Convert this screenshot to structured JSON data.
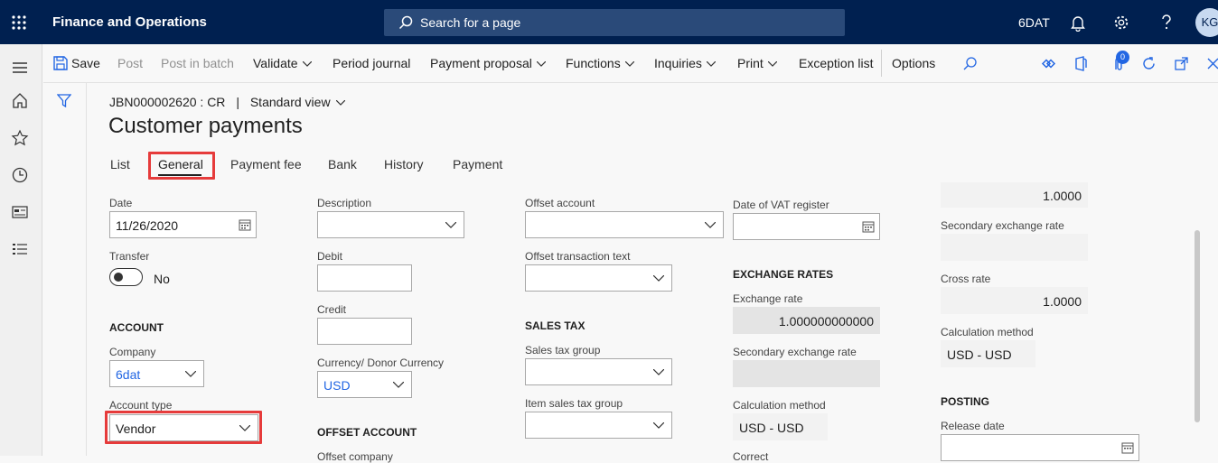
{
  "app": {
    "title": "Finance and Operations",
    "search_placeholder": "Search for a page",
    "company": "6DAT",
    "user_initials": "KG"
  },
  "action_pane": {
    "save": "Save",
    "post": "Post",
    "post_in_batch": "Post in batch",
    "validate": "Validate",
    "period_journal": "Period journal",
    "payment_proposal": "Payment proposal",
    "functions": "Functions",
    "inquiries": "Inquiries",
    "print": "Print",
    "exception_list": "Exception list",
    "options": "Options",
    "attachments_count": "0"
  },
  "page": {
    "breadcrumb_journal": "JBN000002620 : CR",
    "breadcrumb_view": "Standard view",
    "title": "Customer payments"
  },
  "tabs": [
    {
      "label": "List"
    },
    {
      "label": "General"
    },
    {
      "label": "Payment fee"
    },
    {
      "label": "Bank"
    },
    {
      "label": "History"
    },
    {
      "label": "Payment"
    }
  ],
  "form": {
    "date_label": "Date",
    "date_value": "11/26/2020",
    "transfer_label": "Transfer",
    "transfer_value": "No",
    "account_section": "ACCOUNT",
    "company_label": "Company",
    "company_value": "6dat",
    "account_type_label": "Account type",
    "account_type_value": "Vendor",
    "description_label": "Description",
    "description_value": "",
    "debit_label": "Debit",
    "debit_value": "",
    "credit_label": "Credit",
    "credit_value": "",
    "currency_label": "Currency/ Donor Currency",
    "currency_value": "USD",
    "offset_account_section": "OFFSET ACCOUNT",
    "offset_company_label": "Offset company",
    "offset_account_label": "Offset account",
    "offset_account_value": "",
    "offset_text_label": "Offset transaction text",
    "offset_text_value": "",
    "sales_tax_section": "SALES TAX",
    "sales_tax_group_label": "Sales tax group",
    "sales_tax_group_value": "",
    "item_sales_tax_group_label": "Item sales tax group",
    "item_sales_tax_group_value": "",
    "vat_date_label": "Date of VAT register",
    "vat_date_value": "",
    "exchange_rates_section": "EXCHANGE RATES",
    "exchange_rate_label": "Exchange rate",
    "exchange_rate_value": "1.000000000000",
    "secondary_rate_label": "Secondary exchange rate",
    "secondary_rate_value": "",
    "calc_method_label": "Calculation method",
    "calc_method_value": "USD - USD",
    "cut_label": "Correct",
    "r_top_value": "1.0000",
    "r_secondary_label": "Secondary exchange rate",
    "r_secondary_value": "",
    "cross_rate_label": "Cross rate",
    "cross_rate_value": "1.0000",
    "r_calc_label": "Calculation method",
    "r_calc_value": "USD - USD",
    "posting_section": "POSTING",
    "release_date_label": "Release date",
    "release_date_value": ""
  }
}
